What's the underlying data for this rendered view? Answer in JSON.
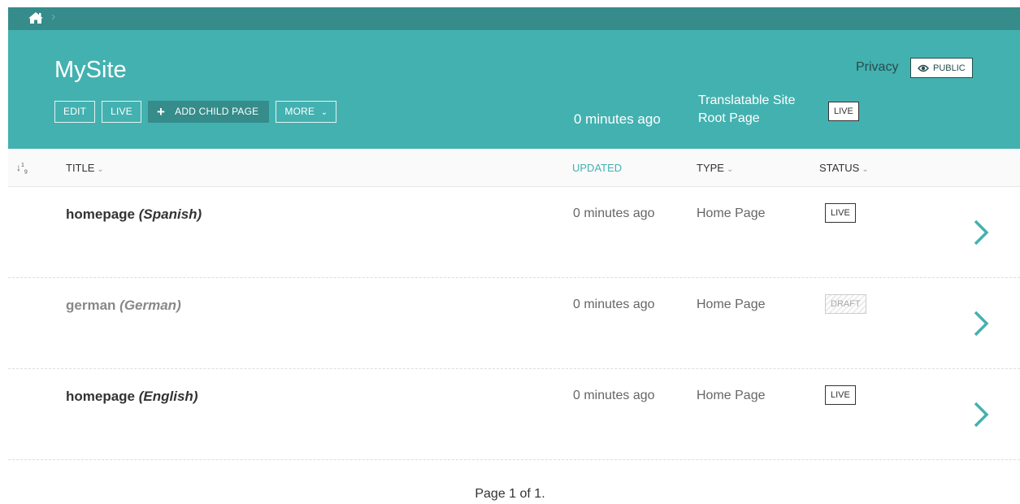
{
  "breadcrumb": {
    "home_icon": "home-icon",
    "separator": "›"
  },
  "header": {
    "title": "MySite",
    "actions": {
      "edit": "EDIT",
      "live": "LIVE",
      "add_child": "ADD CHILD PAGE",
      "more": "MORE"
    },
    "updated": "0 minutes ago",
    "type": "Translatable Site Root Page",
    "status": "LIVE",
    "privacy_label": "Privacy",
    "privacy_button": "PUBLIC"
  },
  "columns": {
    "sort_icon": "sort-numeric-icon",
    "title": "TITLE",
    "updated": "UPDATED",
    "type": "TYPE",
    "status": "STATUS"
  },
  "rows": [
    {
      "title": "homepage",
      "language": "(Spanish)",
      "updated": "0 minutes ago",
      "type": "Home Page",
      "status": "LIVE"
    },
    {
      "title": "german",
      "language": "(German)",
      "updated": "0 minutes ago",
      "type": "Home Page",
      "status": "DRAFT"
    },
    {
      "title": "homepage",
      "language": "(English)",
      "updated": "0 minutes ago",
      "type": "Home Page",
      "status": "LIVE"
    }
  ],
  "pagination": "Page 1 of 1.",
  "colors": {
    "header_bg": "#43b1b0",
    "breadcrumb_bg": "#358c8b",
    "accent": "#43b1b0",
    "privacy_text": "#244d4c"
  }
}
